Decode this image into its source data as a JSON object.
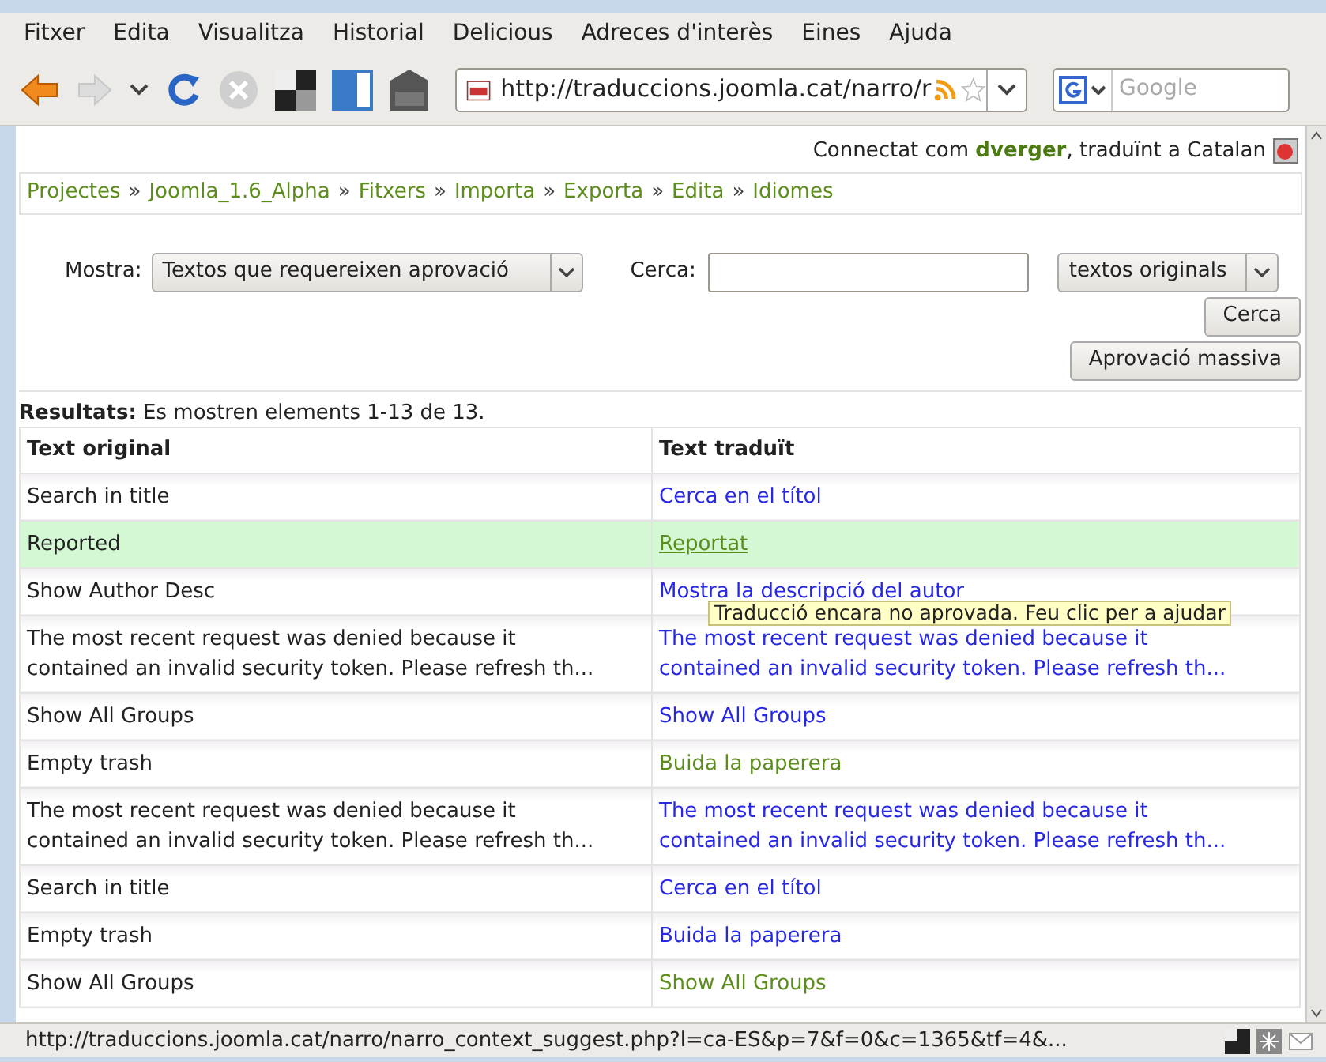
{
  "menu": [
    "Fitxer",
    "Edita",
    "Visualitza",
    "Historial",
    "Delicious",
    "Adreces d'interès",
    "Eines",
    "Ajuda"
  ],
  "toolbar": {
    "url": "http://traduccions.joomla.cat/narro/r",
    "search_placeholder": "Google"
  },
  "user_line": {
    "prefix": "Connectat com ",
    "user": "dverger",
    "suffix": ", traduïnt a Catalan"
  },
  "breadcrumb": [
    "Projectes",
    "Joomla_1.6_Alpha",
    "Fitxers",
    "Importa",
    "Exporta",
    "Edita",
    "Idiomes"
  ],
  "breadcrumb_separator": "»",
  "filters": {
    "show_label": "Mostra:",
    "show_value": "Textos que requereixen aprovació",
    "search_label": "Cerca:",
    "search_in": "textos originals",
    "search_button": "Cerca",
    "mass_button": "Aprovació massiva"
  },
  "results": {
    "label": "Resultats:",
    "text": "Es mostren elements 1-13 de 13."
  },
  "table": {
    "columns": [
      "Text original",
      "Text traduït"
    ],
    "rows": [
      {
        "original": "Search in title",
        "translated": "Cerca en el títol",
        "kind": "suggested",
        "selected": false
      },
      {
        "original": "Reported",
        "translated": "Reportat",
        "kind": "approved",
        "selected": true
      },
      {
        "original": "Show Author Desc",
        "translated": "Mostra la descripció del autor",
        "kind": "suggested",
        "selected": false
      },
      {
        "original": "The most recent request was denied because it contained an invalid security token. Please refresh th...",
        "translated": "The most recent request was denied because it contained an invalid security token. Please refresh th...",
        "kind": "suggested",
        "selected": false
      },
      {
        "original": "Show All Groups",
        "translated": "Show All Groups",
        "kind": "suggested",
        "selected": false
      },
      {
        "original": "Empty trash",
        "translated": "Buida la paperera",
        "kind": "approved",
        "selected": false
      },
      {
        "original": "The most recent request was denied because it contained an invalid security token. Please refresh th...",
        "translated": "The most recent request was denied because it contained an invalid security token. Please refresh th...",
        "kind": "suggested",
        "selected": false
      },
      {
        "original": "Search in title",
        "translated": "Cerca en el títol",
        "kind": "suggested",
        "selected": false
      },
      {
        "original": "Empty trash",
        "translated": "Buida la paperera",
        "kind": "suggested",
        "selected": false
      },
      {
        "original": "Show All Groups",
        "translated": "Show All Groups",
        "kind": "approved",
        "selected": false
      }
    ]
  },
  "tooltip": "Traducció encara no aprovada. Feu clic per a ajudar",
  "status_bar": "http://traduccions.joomla.cat/narro/narro_context_suggest.php?l=ca-ES&p=7&f=0&c=1365&tf=4&..."
}
